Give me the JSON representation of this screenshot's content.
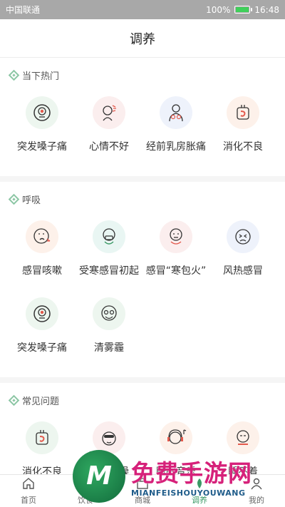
{
  "status_bar": {
    "carrier": "中国联通",
    "battery": "100%",
    "time": "16:48"
  },
  "header": {
    "title": "调养"
  },
  "sections": [
    {
      "title": "当下热门",
      "items": [
        {
          "label": "突发嗓子痛",
          "icon": "sore-throat-icon",
          "bg": "#edf6ef"
        },
        {
          "label": "心情不好",
          "icon": "bad-mood-icon",
          "bg": "#fbeeee"
        },
        {
          "label": "经前乳房胀痛",
          "icon": "breast-pain-icon",
          "bg": "#eef2fb"
        },
        {
          "label": "消化不良",
          "icon": "indigestion-icon",
          "bg": "#fdf1ea"
        }
      ]
    },
    {
      "title": "呼吸",
      "items": [
        {
          "label": "感冒咳嗽",
          "icon": "cough-icon",
          "bg": "#fdf1ea"
        },
        {
          "label": "受寒感冒初起",
          "icon": "cold-chill-icon",
          "bg": "#e9f6f3"
        },
        {
          "label": "感冒“寒包火”",
          "icon": "cold-fire-icon",
          "bg": "#fbeeee"
        },
        {
          "label": "风热感冒",
          "icon": "wind-heat-icon",
          "bg": "#eef2fb"
        },
        {
          "label": "突发嗓子痛",
          "icon": "sore-throat-icon",
          "bg": "#edf6ef"
        },
        {
          "label": "清雾霾",
          "icon": "smog-mask-icon",
          "bg": "#edf6ef"
        }
      ]
    },
    {
      "title": "常见问题",
      "items": [
        {
          "label": "消化不良",
          "icon": "indigestion-icon",
          "bg": "#edf6ef"
        },
        {
          "label": "皮肤干燥",
          "icon": "dry-skin-icon",
          "bg": "#fbeeee"
        },
        {
          "label": "睡眠音乐",
          "icon": "sleep-music-icon",
          "bg": "#fdf1ea"
        },
        {
          "label": "睡不着",
          "icon": "insomnia-icon",
          "bg": "#fdf1ea"
        }
      ]
    }
  ],
  "tabbar": [
    {
      "label": "首页",
      "icon": "home-icon",
      "active": false
    },
    {
      "label": "饮食",
      "icon": "diet-icon",
      "active": false
    },
    {
      "label": "商城",
      "icon": "shop-icon",
      "active": false
    },
    {
      "label": "调养",
      "icon": "care-icon",
      "active": true
    },
    {
      "label": "我的",
      "icon": "profile-icon",
      "active": false
    }
  ],
  "watermark": {
    "logo_letter": "M",
    "title": "免费手游网",
    "subtitle": "MIANFEISHOUYOUWANG"
  },
  "colors": {
    "accent": "#3b9a66",
    "section_diamond": "#8bc6a4",
    "status_bar": "#a8a8a8"
  }
}
